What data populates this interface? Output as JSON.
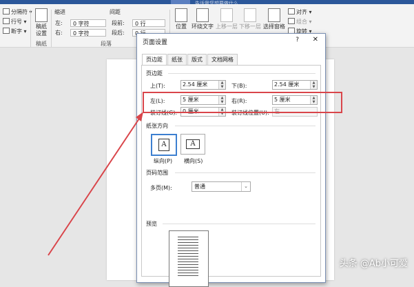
{
  "ribbon": {
    "breaks": "分隔符",
    "line_numbers": "行号",
    "hyphenation": "断字",
    "manuscript": "稿纸\n设置",
    "manuscript_group": "稿纸",
    "indent_header": "缩进",
    "spacing_header": "间距",
    "indent_left_label": "左:",
    "indent_left_value": "0 字符",
    "indent_right_label": "右:",
    "indent_right_value": "0 字符",
    "spacing_before_label": "段前:",
    "spacing_before_value": "0 行",
    "spacing_after_label": "段后:",
    "spacing_after_value": "0 行",
    "paragraph_group": "段落",
    "position": "位置",
    "wrap_text": "环绕文字",
    "bring_forward": "上移一层",
    "send_backward": "下移一层",
    "selection_pane": "选择窗格",
    "align": "对齐",
    "group": "组合",
    "rotate": "旋转",
    "search_placeholder": "告诉我您想要做什么"
  },
  "dialog": {
    "title": "页面设置",
    "help": "?",
    "close": "✕",
    "tabs": [
      "页边距",
      "纸张",
      "版式",
      "文档网格"
    ],
    "margins_header": "页边距",
    "top_label": "上(T):",
    "top_value": "2.54 厘米",
    "bottom_label": "下(B):",
    "bottom_value": "2.54 厘米",
    "left_label": "左(L):",
    "left_value": "5 厘米",
    "right_label": "右(R):",
    "right_value": "5 厘米",
    "gutter_label": "装订线(G):",
    "gutter_value": "0 厘米",
    "gutter_pos_label": "装订线位置(U):",
    "gutter_pos_value": "左",
    "orientation_header": "纸张方向",
    "portrait": "纵向(P)",
    "landscape": "横向(S)",
    "pages_header": "页码范围",
    "multiple_pages_label": "多页(M):",
    "multiple_pages_value": "普通",
    "preview_header": "预览"
  },
  "watermark": "头条 @Ab小可爱",
  "colors": {
    "highlight": "#d9454a",
    "accent": "#2b579a"
  }
}
